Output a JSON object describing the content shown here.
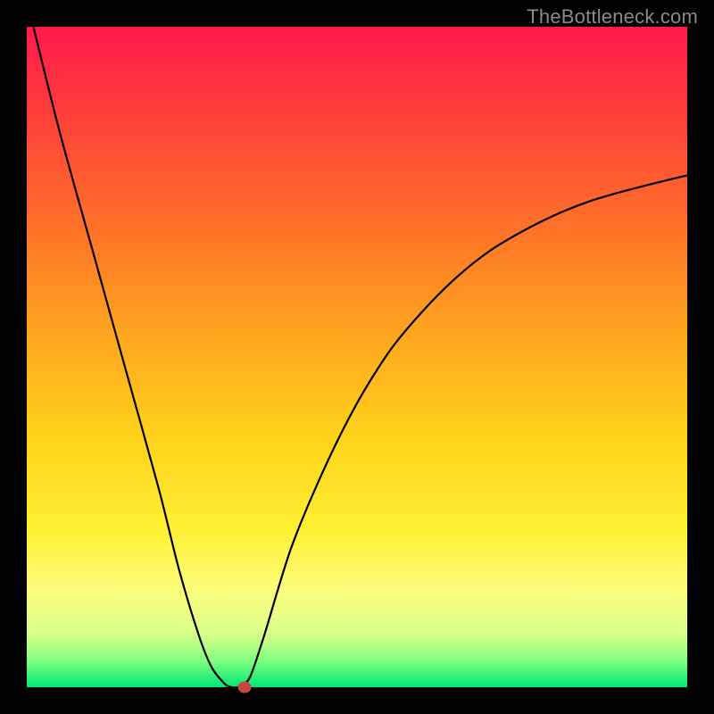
{
  "watermark": "TheBottleneck.com",
  "chart_data": {
    "type": "line",
    "title": "",
    "xlabel": "",
    "ylabel": "",
    "xlim": [
      0,
      100
    ],
    "ylim": [
      0,
      100
    ],
    "grid": false,
    "legend": false,
    "series": [
      {
        "name": "curve",
        "x": [
          1,
          5,
          10,
          15,
          20,
          23,
          26,
          28,
          30,
          31,
          32,
          33,
          34,
          36,
          40,
          45,
          50,
          55,
          60,
          65,
          70,
          75,
          80,
          85,
          90,
          95,
          100
        ],
        "values": [
          100,
          84,
          66,
          48,
          30,
          18,
          8,
          3,
          0.5,
          0,
          0,
          0.5,
          2,
          8,
          21,
          33,
          43,
          51,
          57,
          62,
          66,
          69,
          71.5,
          73.5,
          75,
          76.3,
          77.5
        ]
      }
    ],
    "marker": {
      "x": 33,
      "y": 0
    },
    "background": {
      "gradient_stops": [
        {
          "pos": 0,
          "color": "#ff1a4d"
        },
        {
          "pos": 12,
          "color": "#ff3b3b"
        },
        {
          "pos": 28,
          "color": "#ff6a2a"
        },
        {
          "pos": 45,
          "color": "#ffa01f"
        },
        {
          "pos": 62,
          "color": "#ffd21a"
        },
        {
          "pos": 76,
          "color": "#ffef33"
        },
        {
          "pos": 85,
          "color": "#fdfd7a"
        },
        {
          "pos": 92,
          "color": "#d8ff8a"
        },
        {
          "pos": 96,
          "color": "#7fff7f"
        },
        {
          "pos": 100,
          "color": "#00e676"
        }
      ]
    }
  }
}
